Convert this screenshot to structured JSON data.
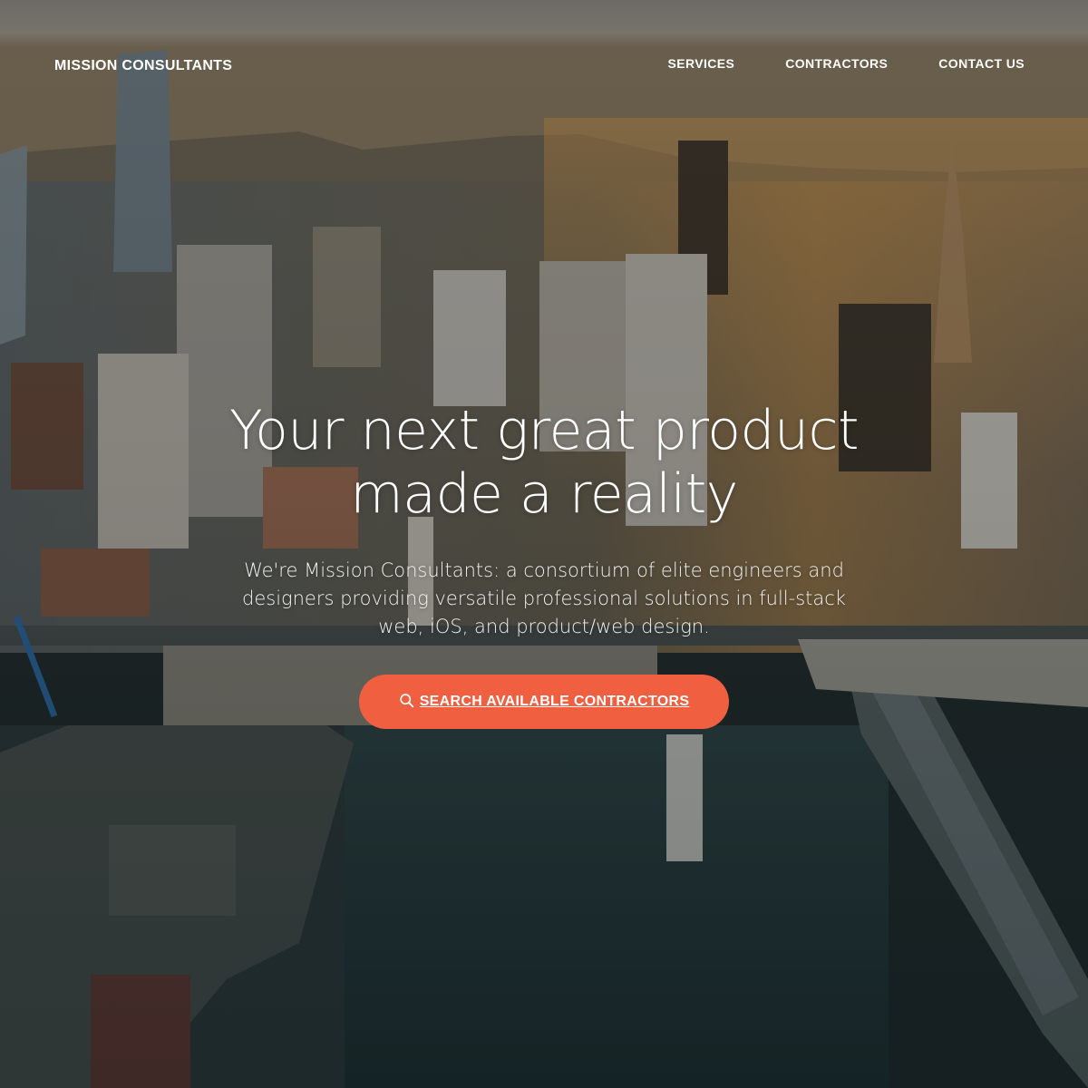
{
  "navbar": {
    "brand": "MISSION CONSULTANTS",
    "links": [
      {
        "label": "SERVICES"
      },
      {
        "label": "CONTRACTORS"
      },
      {
        "label": "CONTACT US"
      }
    ]
  },
  "hero": {
    "headline": "Your next great product made a reality",
    "subtitle": "We're Mission Consultants: a consortium of elite engineers and designers providing versatile professional solutions in full-stack web, iOS, and product/web design.",
    "cta": {
      "label": "SEARCH AVAILABLE CONTRACTORS",
      "icon": "search-icon"
    },
    "background_image": "aerial-city-waterfront-photo"
  },
  "colors": {
    "accent": "#f05f40",
    "text": "#ffffff"
  }
}
